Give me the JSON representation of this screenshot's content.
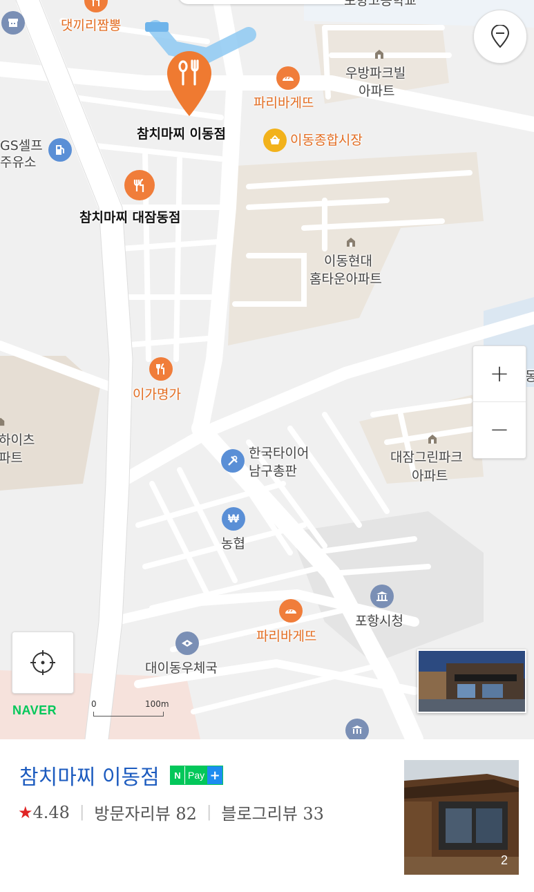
{
  "map": {
    "labels": {
      "top_partial_school": "포항고등학교",
      "datkkiri": "댓끼리짬뽕",
      "gs_self_1": "GS셀프",
      "gs_self_2": "주유소",
      "chamchi_idong": "참치마찌 이동점",
      "chamchi_daejam": "참치마찌 대잠동점",
      "paris_top": "파리바게뜨",
      "idong_market": "이동종합시장",
      "woobang_1": "우방파크빌",
      "woobang_2": "아파트",
      "idong_hyundai_1": "이동현대",
      "idong_hyundai_2": "홈타운아파트",
      "igamyeongga": "이가명가",
      "heights_1": "하이츠",
      "heights_2": "파트",
      "hankook_1": "한국타이어",
      "hankook_2": "남구총판",
      "daejam_green_1": "대잠그린파크",
      "daejam_green_2": "아파트",
      "nonghyup": "농협",
      "paris_bottom": "파리바게뜨",
      "pohang_cityhall": "포항시청",
      "daeidong_post": "대이동우체국",
      "right_partial": "동"
    },
    "controls": {
      "zoom_in": "+",
      "zoom_out": "−"
    },
    "icons": {
      "location_pin": "location-pin-icon",
      "current_location": "crosshair-icon"
    },
    "brand": "NAVER",
    "scale": {
      "start": "0",
      "end": "100m"
    },
    "colors": {
      "poi_orange": "#f07d3a",
      "poi_blue": "#5a8fd6",
      "market_yellow": "#f2b21b",
      "route_blue": "#8ec9f2"
    }
  },
  "place": {
    "name": "참치마찌 이동점",
    "npay": {
      "n": "N",
      "pay": "Pay",
      "plus": "+"
    },
    "rating_star": "★",
    "rating": "4.48",
    "visitor_reviews": "방문자리뷰 82",
    "blog_reviews": "블로그리뷰 33",
    "photo_count": "2"
  }
}
